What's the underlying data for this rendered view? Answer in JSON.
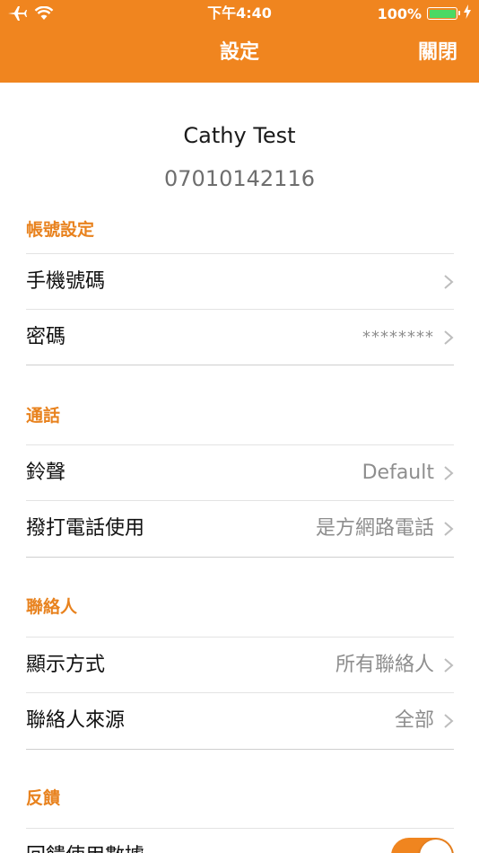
{
  "status_bar": {
    "time": "下午4:40",
    "battery_percent": "100%",
    "battery_level": 1.0,
    "icons": [
      "airplane-icon",
      "wifi-icon",
      "battery-icon",
      "charging-bolt-icon"
    ]
  },
  "nav": {
    "title": "設定",
    "close_label": "關閉"
  },
  "profile": {
    "name": "Cathy Test",
    "phone": "07010142116"
  },
  "sections": {
    "account": {
      "title": "帳號設定",
      "rows": [
        {
          "label": "手機號碼",
          "value": ""
        },
        {
          "label": "密碼",
          "value": "********"
        }
      ]
    },
    "calls": {
      "title": "通話",
      "rows": [
        {
          "label": "鈴聲",
          "value": "Default"
        },
        {
          "label": "撥打電話使用",
          "value": "是方網路電話"
        }
      ]
    },
    "contacts": {
      "title": "聯絡人",
      "rows": [
        {
          "label": "顯示方式",
          "value": "所有聯絡人"
        },
        {
          "label": "聯絡人來源",
          "value": "全部"
        }
      ]
    },
    "feedback": {
      "title": "反饋",
      "rows": [
        {
          "label": "回饋使用數據",
          "toggle_on": true
        }
      ]
    }
  },
  "colors": {
    "accent": "#f0851f",
    "section_title": "#e8821e",
    "value_text": "#8e8e8e",
    "battery_green": "#4cd964"
  }
}
